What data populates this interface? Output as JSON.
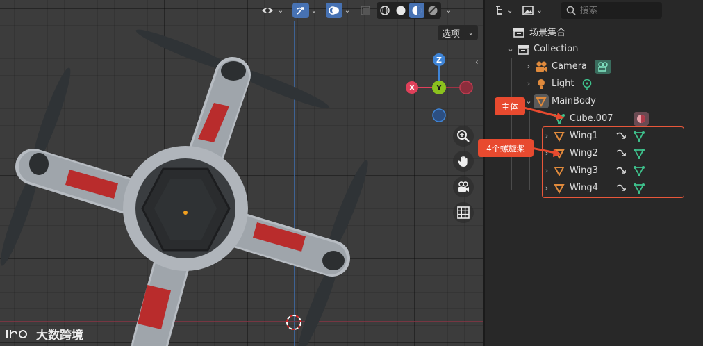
{
  "viewport": {
    "options_label": "选项",
    "gizmo": {
      "x": "X",
      "y": "Y",
      "z": "Z"
    }
  },
  "outliner": {
    "search_placeholder": "搜索",
    "items": [
      {
        "label": "场景集合",
        "type": "scene-collection"
      },
      {
        "label": "Collection",
        "type": "collection"
      },
      {
        "label": "Camera",
        "type": "camera"
      },
      {
        "label": "Light",
        "type": "light"
      },
      {
        "label": "MainBody",
        "type": "mesh"
      },
      {
        "label": "Cube.007",
        "type": "mesh-data"
      },
      {
        "label": "Wing1",
        "type": "mesh"
      },
      {
        "label": "Wing2",
        "type": "mesh"
      },
      {
        "label": "Wing3",
        "type": "mesh"
      },
      {
        "label": "Wing4",
        "type": "mesh"
      }
    ]
  },
  "annotations": {
    "main_body": "主体",
    "propellers": "4个螺旋桨"
  },
  "watermark": {
    "text": "大数跨境"
  },
  "colors": {
    "accent": "#4772b3",
    "object_orange": "#e08a3c",
    "data_green": "#3ec18c",
    "callout_red": "#e84a2f",
    "axis_x": "#e0405a",
    "axis_y": "#8bc21e",
    "axis_z": "#3f84d6"
  }
}
